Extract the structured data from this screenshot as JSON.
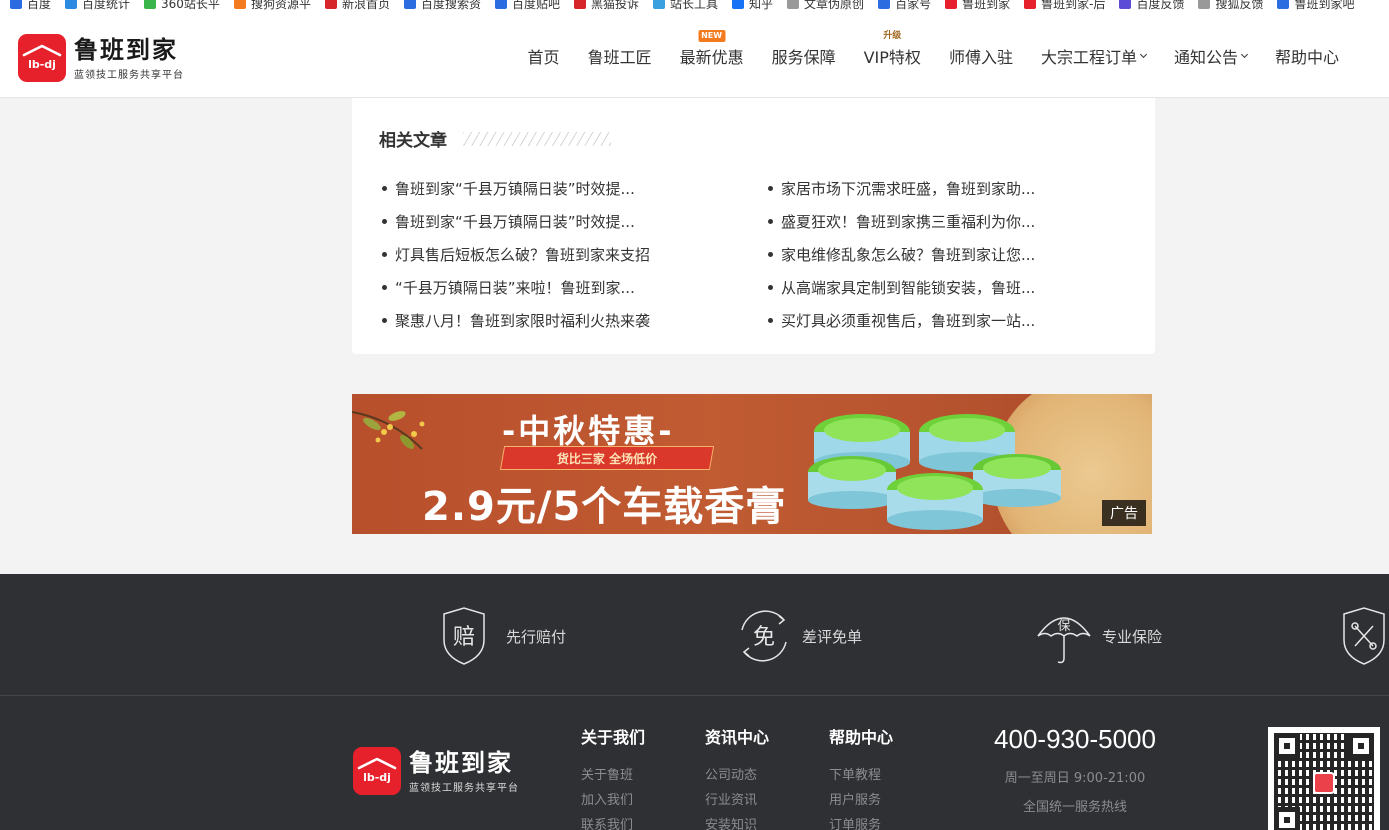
{
  "bookmarks": [
    {
      "label": "百度",
      "color": "#2b6de0"
    },
    {
      "label": "百度统计",
      "color": "#2b8be0"
    },
    {
      "label": "360站长平",
      "color": "#3ab54a"
    },
    {
      "label": "搜狗资源平",
      "color": "#f47a20"
    },
    {
      "label": "新浪首页",
      "color": "#d7262a"
    },
    {
      "label": "百度搜索资",
      "color": "#2b6de0"
    },
    {
      "label": "百度贴吧",
      "color": "#2b6de0"
    },
    {
      "label": "黑猫投诉",
      "color": "#d7262a"
    },
    {
      "label": "站长工具",
      "color": "#3aa0e0"
    },
    {
      "label": "知乎",
      "color": "#1772f6"
    },
    {
      "label": "文章伪原创",
      "color": "#999999"
    },
    {
      "label": "百家号",
      "color": "#2b6de0"
    },
    {
      "label": "鲁班到家",
      "color": "#e7212b"
    },
    {
      "label": "鲁班到家-后",
      "color": "#e7212b"
    },
    {
      "label": "百度反馈",
      "color": "#5b4bd6"
    },
    {
      "label": "搜狐反馈",
      "color": "#999999"
    },
    {
      "label": "鲁班到家吧",
      "color": "#2b6de0"
    }
  ],
  "header": {
    "logo_title": "鲁班到家",
    "logo_sub": "蓝领技工服务共享平台",
    "nav": [
      {
        "label": "首页"
      },
      {
        "label": "鲁班工匠"
      },
      {
        "label": "最新优惠",
        "badge": "NEW"
      },
      {
        "label": "服务保障"
      },
      {
        "label": "VIP特权",
        "badge": "升级"
      },
      {
        "label": "师傅入驻"
      },
      {
        "label": "大宗工程订单"
      },
      {
        "label": "通知公告"
      },
      {
        "label": "帮助中心"
      }
    ]
  },
  "related": {
    "title": "相关文章",
    "left": [
      "鲁班到家“千县万镇隔日装”时效提...",
      "鲁班到家“千县万镇隔日装”时效提...",
      "灯具售后短板怎么破？鲁班到家来支招",
      "“千县万镇隔日装”来啦！鲁班到家...",
      "聚惠八月！鲁班到家限时福利火热来袭"
    ],
    "right": [
      "家居市场下沉需求旺盛，鲁班到家助...",
      "盛夏狂欢！鲁班到家携三重福利为你...",
      "家电维修乱象怎么破？鲁班到家让您...",
      "从高端家具定制到智能锁安装，鲁班...",
      "买灯具必须重视售后，鲁班到家一站..."
    ]
  },
  "ad": {
    "title": "-中秋特惠-",
    "ribbon": "货比三家 全场低价",
    "price": "2.9元/5个车载香膏",
    "tag": "广告"
  },
  "footer": {
    "guarantees": [
      {
        "icon_char": "赔",
        "label": "先行赔付"
      },
      {
        "icon_char": "免",
        "label": "差评免单"
      },
      {
        "icon_char": "保",
        "label": "专业保险"
      }
    ],
    "logo_title": "鲁班到家",
    "logo_sub": "蓝领技工服务共享平台",
    "columns": [
      {
        "title": "关于我们",
        "links": [
          "关于鲁班",
          "加入我们",
          "联系我们"
        ]
      },
      {
        "title": "资讯中心",
        "links": [
          "公司动态",
          "行业资讯",
          "安装知识"
        ]
      },
      {
        "title": "帮助中心",
        "links": [
          "下单教程",
          "用户服务",
          "订单服务"
        ]
      }
    ],
    "hotline": "400-930-5000",
    "hours": "周一至周日 9:00-21:00",
    "hotline_desc": "全国统一服务热线"
  },
  "colors": {
    "brand_red": "#e7212b",
    "footer_bg": "#2f3034",
    "page_bg": "#f3f3f3"
  }
}
